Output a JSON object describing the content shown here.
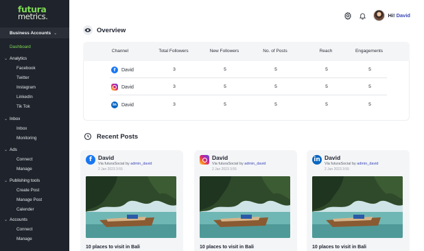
{
  "brand": {
    "logo_line1": "futura",
    "logo_line2": "metrics."
  },
  "sidebar": {
    "account_switcher": "Business Accounts",
    "active_item": "Dashboard",
    "groups": [
      {
        "label": "Analytics",
        "items": [
          "Facebook",
          "Twitter",
          "Instagram",
          "LinkedIn",
          "Tik Tok"
        ]
      },
      {
        "label": "Inbox",
        "items": [
          "Inbox",
          "Monitoring"
        ]
      },
      {
        "label": "Ads",
        "items": [
          "Connect",
          "Manage"
        ]
      },
      {
        "label": "Publishing tools",
        "items": [
          "Create Post",
          "Manage Post",
          "Calender"
        ]
      },
      {
        "label": "Accounts",
        "items": [
          "Connect",
          "Manage"
        ]
      }
    ]
  },
  "header": {
    "greeting": "Hi!",
    "user_name": "David",
    "icons": [
      "settings-icon",
      "bell-icon",
      "avatar"
    ]
  },
  "overview": {
    "title": "Overview",
    "columns": [
      "Channel",
      "Total Followers",
      "New Followers",
      "No. of Posts",
      "Reach",
      "Engagements"
    ],
    "rows": [
      {
        "platform": "facebook",
        "name": "David",
        "total_followers": "3",
        "new_followers": "5",
        "posts": "5",
        "reach": "5",
        "engagements": "5"
      },
      {
        "platform": "instagram",
        "name": "David",
        "total_followers": "3",
        "new_followers": "5",
        "posts": "5",
        "reach": "5",
        "engagements": "5"
      },
      {
        "platform": "linkedin",
        "name": "David",
        "total_followers": "3",
        "new_followers": "5",
        "posts": "5",
        "reach": "5",
        "engagements": "5"
      }
    ]
  },
  "recent_posts": {
    "title": "Recent Posts",
    "posts": [
      {
        "platform": "facebook",
        "author": "David",
        "via_prefix": "Via futuraSocial by",
        "via_user": "admin_david",
        "date": "2 Jan 2023 3:55",
        "caption": "10 places to visit in Bali"
      },
      {
        "platform": "instagram",
        "author": "David",
        "via_prefix": "Via futuraSocial by",
        "via_user": "admin_david",
        "date": "2 Jan 2023 3:55",
        "caption": "10 places to visit in Bali"
      },
      {
        "platform": "linkedin",
        "author": "David",
        "via_prefix": "Via futuraSocial by",
        "via_user": "admin_david",
        "date": "2 Jan 2023 3:55",
        "caption": "10 places to visit in Bali"
      }
    ]
  },
  "colors": {
    "sidebar_bg": "#1f232b",
    "accent_green": "#7ed957",
    "link_blue": "#3b48b8",
    "panel_bg": "#f4f5f7"
  }
}
